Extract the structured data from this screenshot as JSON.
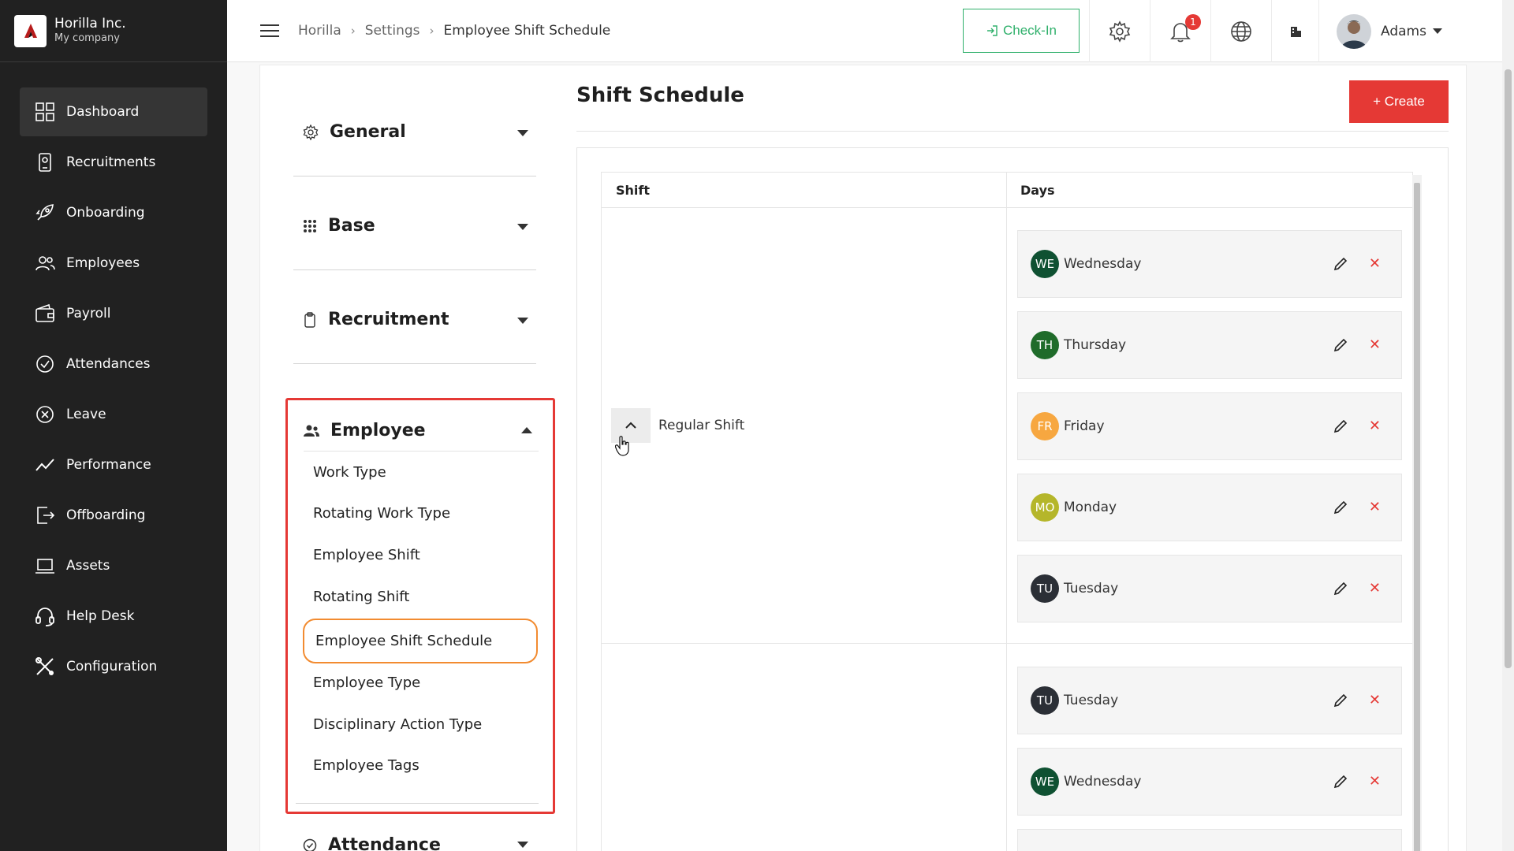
{
  "brand": {
    "name": "Horilla Inc.",
    "subtitle": "My company"
  },
  "sidebar": {
    "items": [
      {
        "label": "Dashboard",
        "icon": "dashboard-icon",
        "active": true
      },
      {
        "label": "Recruitments",
        "icon": "recruitment-icon"
      },
      {
        "label": "Onboarding",
        "icon": "rocket-icon"
      },
      {
        "label": "Employees",
        "icon": "users-icon"
      },
      {
        "label": "Payroll",
        "icon": "wallet-icon"
      },
      {
        "label": "Attendances",
        "icon": "check-circle-icon"
      },
      {
        "label": "Leave",
        "icon": "x-circle-icon"
      },
      {
        "label": "Performance",
        "icon": "trend-icon"
      },
      {
        "label": "Offboarding",
        "icon": "exit-icon"
      },
      {
        "label": "Assets",
        "icon": "laptop-icon"
      },
      {
        "label": "Help Desk",
        "icon": "headset-icon"
      },
      {
        "label": "Configuration",
        "icon": "tools-icon"
      }
    ]
  },
  "topbar": {
    "breadcrumbs": [
      "Horilla",
      "Settings",
      "Employee Shift Schedule"
    ],
    "checkin_label": "Check-In",
    "notification_count": "1",
    "user_name": "Adams"
  },
  "settings_menu": {
    "sections": [
      {
        "title": "General",
        "icon": "gear-icon"
      },
      {
        "title": "Base",
        "icon": "grid-dots-icon"
      },
      {
        "title": "Recruitment",
        "icon": "clipboard-icon"
      },
      {
        "title": "Employee",
        "icon": "people-icon",
        "expanded": true
      }
    ],
    "employee_items": [
      "Work Type",
      "Rotating Work Type",
      "Employee Shift",
      "Rotating Shift",
      "Employee Shift Schedule",
      "Employee Type",
      "Disciplinary Action Type",
      "Employee Tags"
    ],
    "active_item": "Employee Shift Schedule",
    "next_section": {
      "title": "Attendance",
      "icon": "check-circle-icon"
    }
  },
  "main": {
    "title": "Shift Schedule",
    "create_label": "+ Create",
    "columns": {
      "shift": "Shift",
      "days": "Days"
    },
    "rows": [
      {
        "shift": "Regular Shift",
        "days": [
          {
            "abbr": "WE",
            "name": "Wednesday",
            "color": "#0f5132"
          },
          {
            "abbr": "TH",
            "name": "Thursday",
            "color": "#1f6b2a"
          },
          {
            "abbr": "FR",
            "name": "Friday",
            "color": "#f7a740"
          },
          {
            "abbr": "MO",
            "name": "Monday",
            "color": "#b5b62a"
          },
          {
            "abbr": "TU",
            "name": "Tuesday",
            "color": "#2b2f36"
          }
        ]
      },
      {
        "shift": "",
        "days": [
          {
            "abbr": "TU",
            "name": "Tuesday",
            "color": "#2b2f36"
          },
          {
            "abbr": "WE",
            "name": "Wednesday",
            "color": "#0f5132"
          }
        ]
      }
    ]
  },
  "colors": {
    "accent": "#e53935",
    "active_border": "#f28b30",
    "checkin": "#2fb06b",
    "sidebar_bg": "#212121"
  }
}
